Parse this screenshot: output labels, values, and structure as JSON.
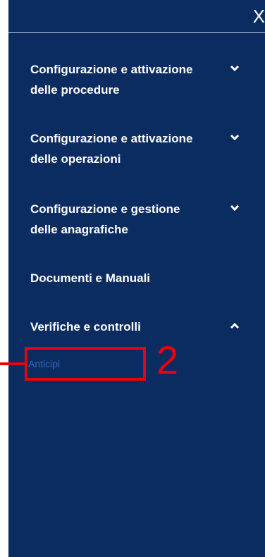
{
  "header": {
    "close_label": "X"
  },
  "menu": {
    "items": [
      {
        "label": "Configurazione e attivazione delle procedure",
        "expanded": false,
        "icon": "chevron-down-icon"
      },
      {
        "label": "Configurazione e attivazione delle operazioni",
        "expanded": false,
        "icon": "chevron-down-icon"
      },
      {
        "label": "Configurazione e gestione delle anagrafiche",
        "expanded": false,
        "icon": "chevron-down-icon"
      },
      {
        "label": "Documenti e Manuali"
      },
      {
        "label": "Verifiche e controlli",
        "expanded": true,
        "icon": "chevron-up-icon",
        "subitems": [
          {
            "label": "Anticipi"
          }
        ]
      }
    ]
  },
  "annotation": {
    "step_number": "2",
    "color": "#e8000a"
  },
  "colors": {
    "panel_bg": "#0b2c61",
    "text": "#ffffff",
    "subitem_text": "#2d69c2"
  }
}
